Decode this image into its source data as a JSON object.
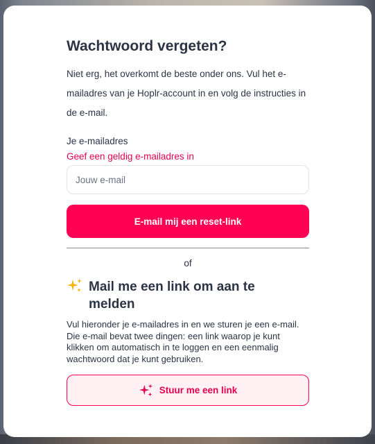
{
  "form": {
    "title": "Wachtwoord vergeten?",
    "intro": "Niet erg, het overkomt de beste onder ons. Vul het e-mailadres van je Hoplr-account in en volg de instructies in de e-mail.",
    "email_label": "Je e-mailadres",
    "email_error": "Geef een geldig e-mailadres in",
    "email_placeholder": "Jouw e-mail",
    "email_value": "",
    "reset_button_label": "E-mail mij een reset-link"
  },
  "separator": {
    "label": "of"
  },
  "magic_link": {
    "title": "Mail me een link om aan te melden",
    "description": "Vul hieronder je e-mailadres in en we sturen je een e-mail. Die e-mail bevat twee dingen: een link waarop je kunt klikken om automatisch in te loggen en een eenmalig wachtwoord dat je kunt gebruiken.",
    "button_label": "Stuur me een link",
    "title_icon": "sparkles-icon",
    "button_icon": "sparkles-icon"
  },
  "colors": {
    "accent": "#ff0055",
    "error": "#e5004f",
    "text": "#2b3345",
    "sparkle_yellow": "#f5b400",
    "link_button_bg": "#fff0f4"
  }
}
